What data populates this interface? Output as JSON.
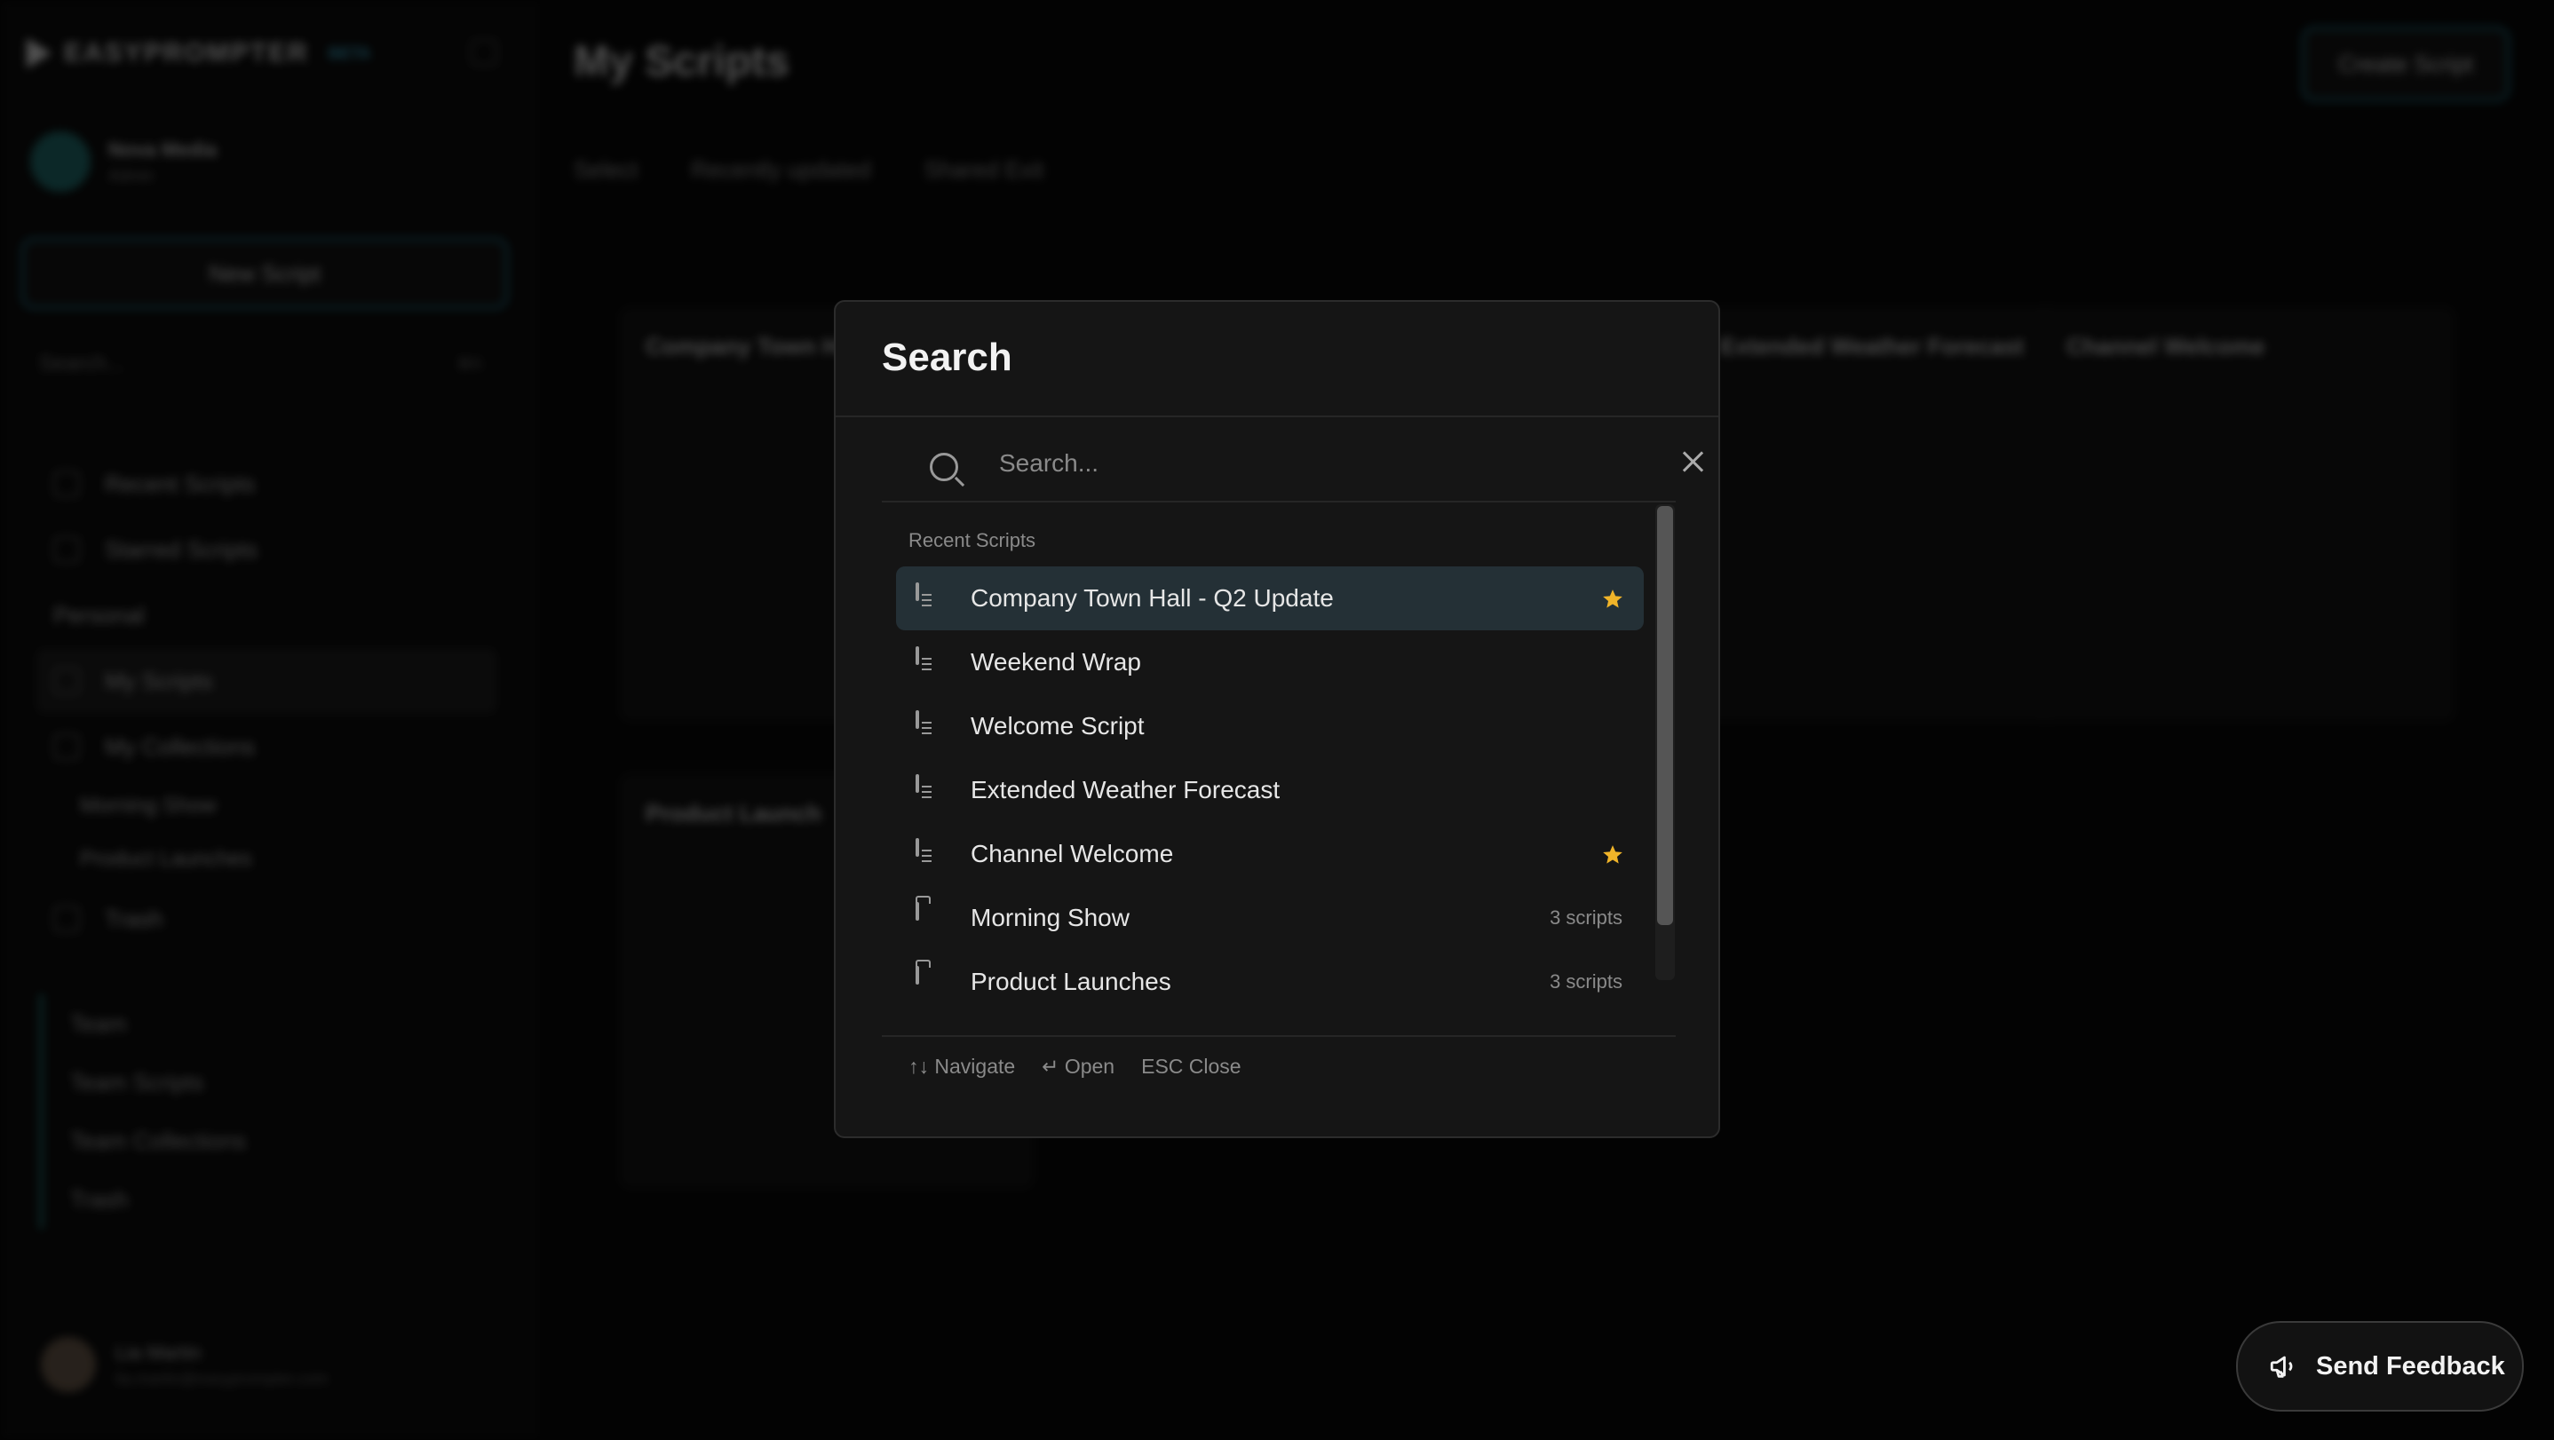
{
  "app": {
    "brand": "EASYPROMPTER",
    "brand_badge": "BETA",
    "user_name": "Nova Media",
    "user_role": "Admin",
    "new_script_label": "New Script",
    "sidebar_search": "Search...",
    "sidebar_search_shortcut": "⌘K",
    "nav": [
      {
        "label": "Recent Scripts"
      },
      {
        "label": "Starred Scripts"
      },
      {
        "label": "Personal"
      },
      {
        "label": "My Scripts"
      },
      {
        "label": "My Collections"
      },
      {
        "label": "Morning Show"
      },
      {
        "label": "Product Launches"
      },
      {
        "label": "Trash"
      }
    ],
    "team": [
      {
        "label": "Team"
      },
      {
        "label": "Team Scripts"
      },
      {
        "label": "Team Collections"
      },
      {
        "label": "Trash"
      }
    ],
    "footer_user": "Lia Martin",
    "footer_email": "lia.martin@easyprompter.com",
    "page_title": "My Scripts",
    "create_label": "Create Script",
    "toolbar": [
      "Select",
      "Recently updated",
      "Shared Exit"
    ],
    "cards": [
      {
        "title": "Company Town Hall - Q2 Update"
      },
      {
        "title": "Extended Weather Forecast"
      },
      {
        "title": "Channel Welcome"
      },
      {
        "title": "Product Launch"
      }
    ]
  },
  "search": {
    "title": "Search",
    "placeholder": "Search...",
    "section_label": "Recent Scripts",
    "results": [
      {
        "label": "Company Town Hall - Q2 Update",
        "icon": "document-icon",
        "starred": true,
        "meta": ""
      },
      {
        "label": "Weekend Wrap",
        "icon": "document-icon",
        "starred": false,
        "meta": ""
      },
      {
        "label": "Welcome Script",
        "icon": "document-icon",
        "starred": false,
        "meta": ""
      },
      {
        "label": "Extended Weather Forecast",
        "icon": "document-icon",
        "starred": false,
        "meta": ""
      },
      {
        "label": "Channel Welcome",
        "icon": "document-icon",
        "starred": true,
        "meta": ""
      },
      {
        "label": "Morning Show",
        "icon": "folder-icon",
        "starred": false,
        "meta": "3 scripts"
      },
      {
        "label": "Product Launches",
        "icon": "folder-icon",
        "starred": false,
        "meta": "3 scripts"
      }
    ],
    "hints": {
      "navigate": "↑↓ Navigate",
      "open": "↵ Open",
      "close": "ESC Close"
    }
  },
  "feedback": {
    "label": "Send Feedback"
  },
  "colors": {
    "accent": "#1f7b93",
    "star": "#f0b429",
    "active_row": "#243036"
  }
}
